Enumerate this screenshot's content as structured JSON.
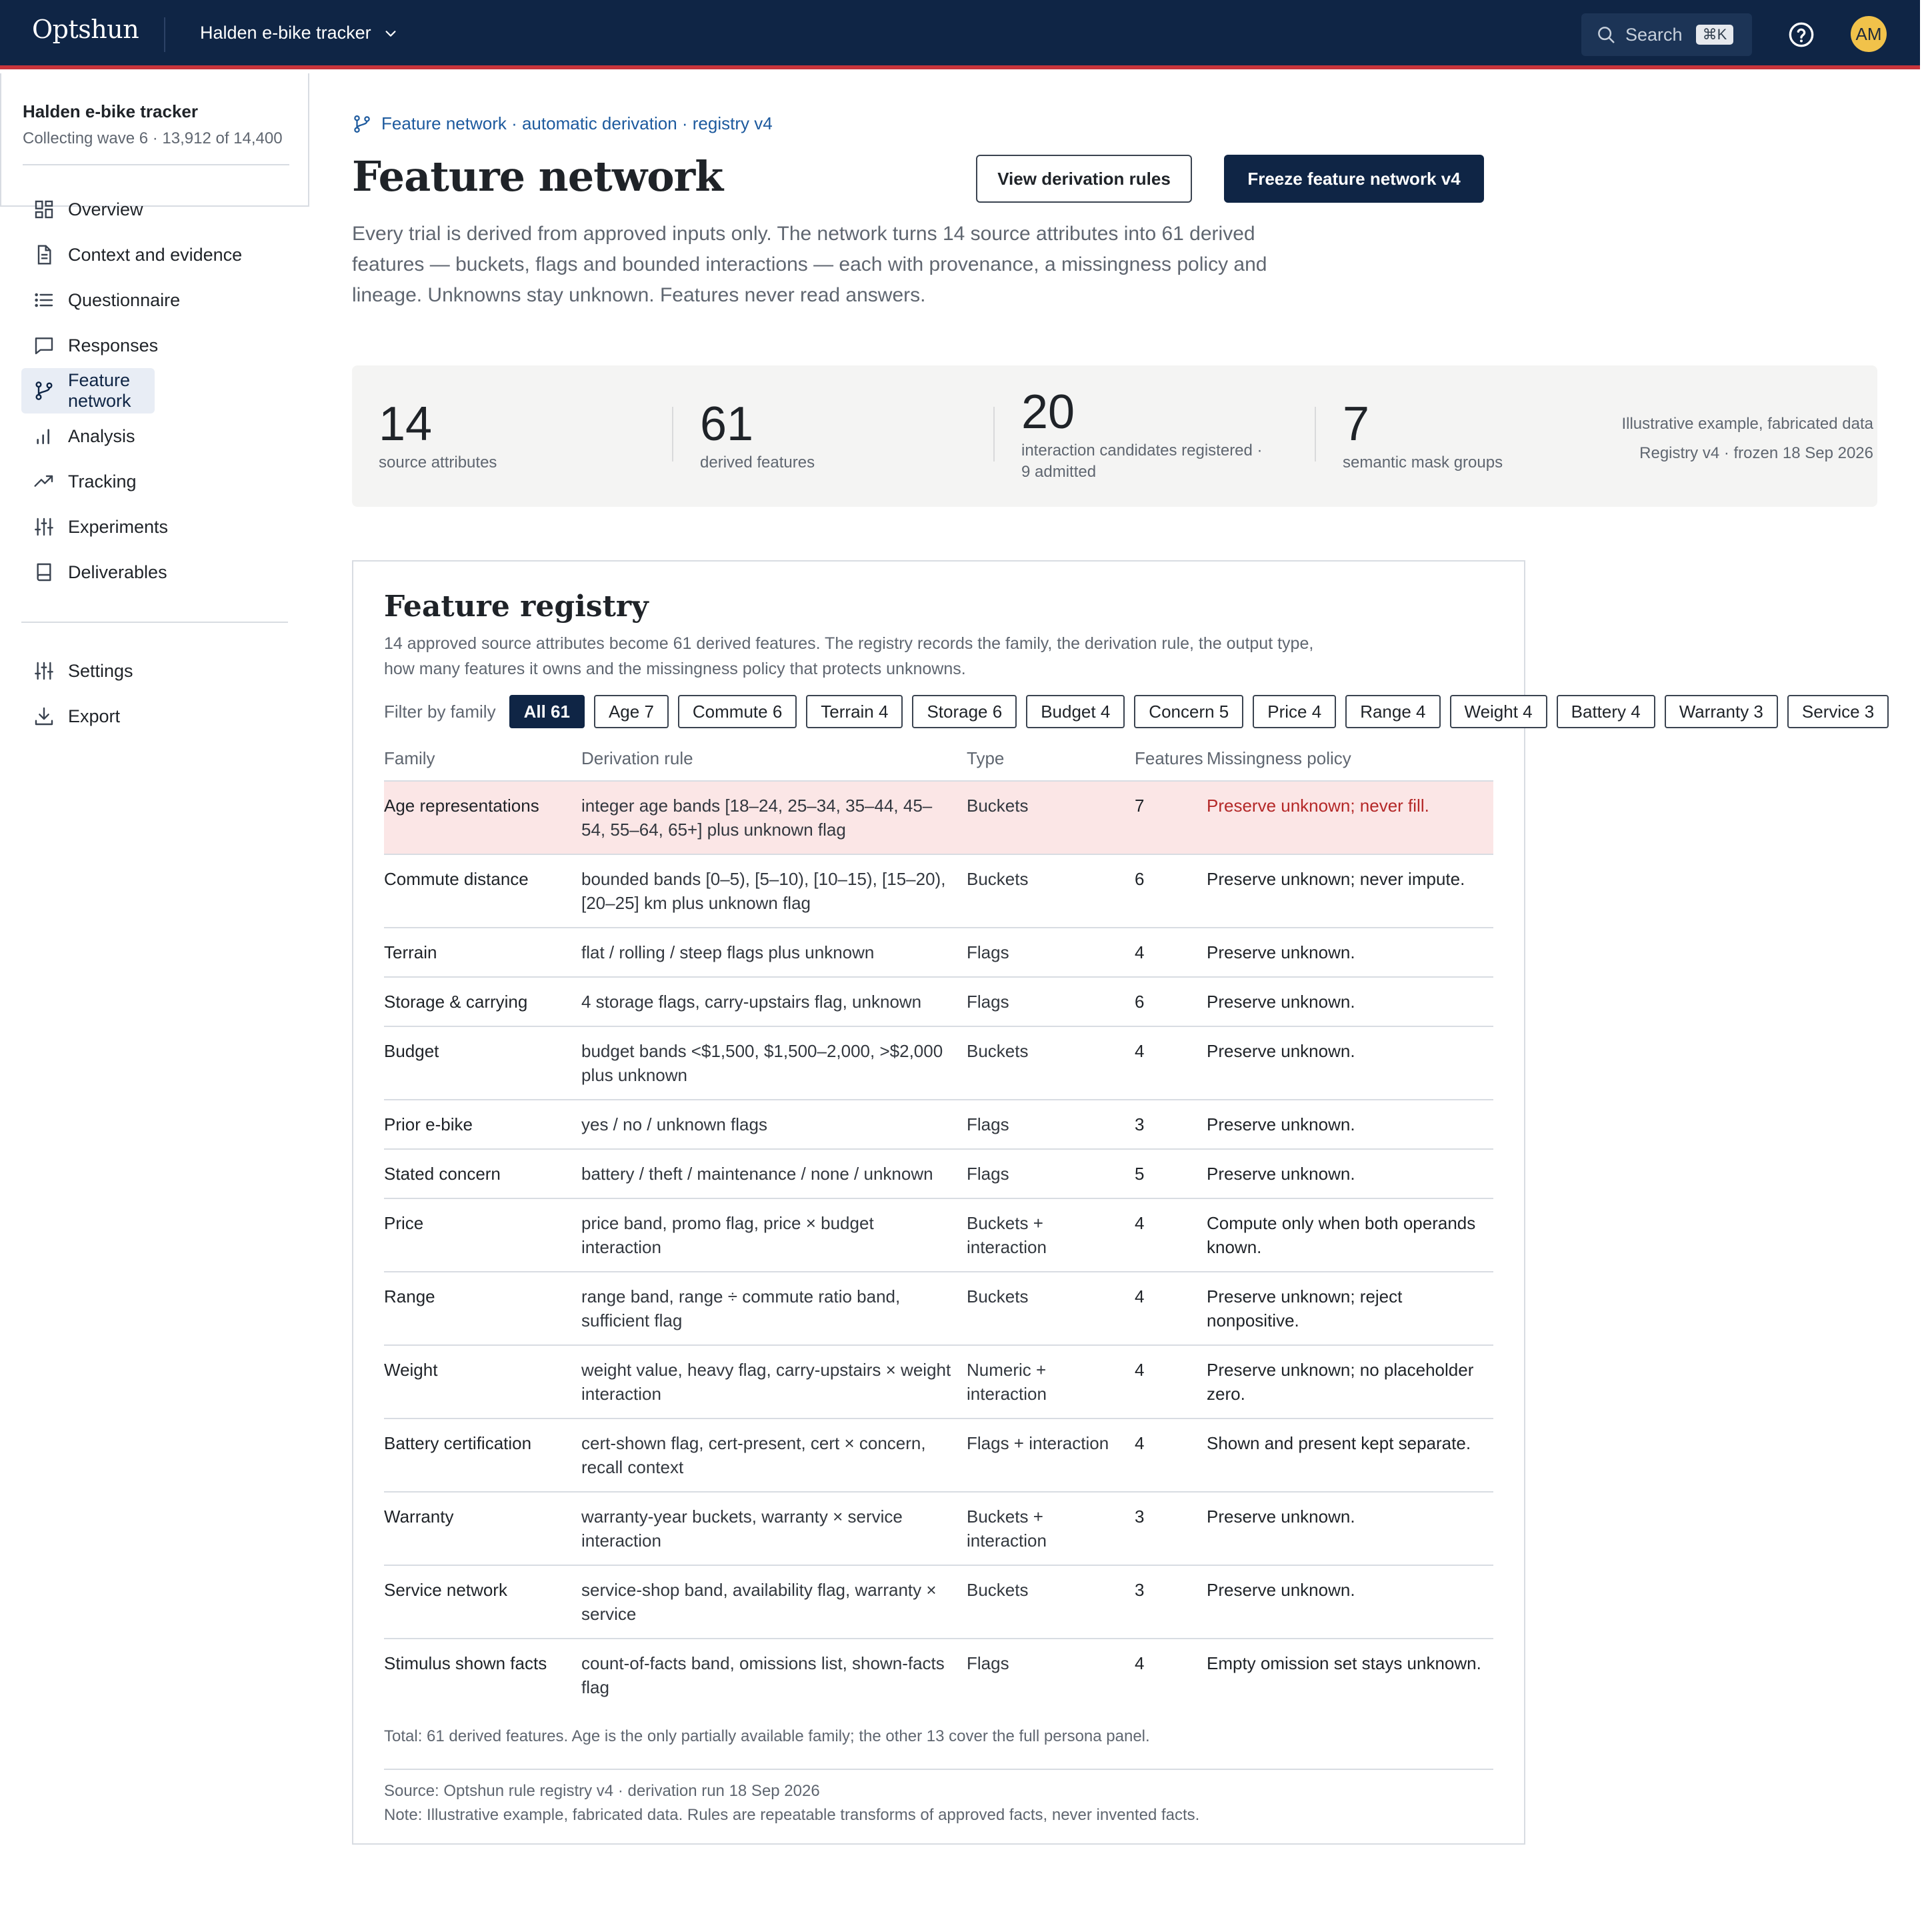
{
  "header": {
    "brand": "Optshun",
    "project_switcher": "Halden e-bike tracker",
    "search_label": "Search",
    "search_shortcut": "⌘K",
    "avatar_initials": "AM",
    "colors": {
      "bar": "#0f2545",
      "accent_line": "#c8343b",
      "avatar": "#f1c24a"
    }
  },
  "sidebar": {
    "project_name": "Halden e-bike tracker",
    "project_meta": "Collecting wave 6 · 13,912 of 14,400",
    "items": [
      {
        "label": "Overview",
        "icon": "grid-icon"
      },
      {
        "label": "Context and evidence",
        "icon": "document-icon"
      },
      {
        "label": "Questionnaire",
        "icon": "list-icon"
      },
      {
        "label": "Responses",
        "icon": "chat-icon"
      },
      {
        "label": "Feature network",
        "icon": "branch-icon",
        "active": true
      },
      {
        "label": "Analysis",
        "icon": "bar-chart-icon"
      },
      {
        "label": "Tracking",
        "icon": "trend-up-icon"
      },
      {
        "label": "Experiments",
        "icon": "sliders-icon"
      },
      {
        "label": "Deliverables",
        "icon": "book-icon"
      }
    ],
    "secondary": [
      {
        "label": "Settings",
        "icon": "sliders-icon"
      },
      {
        "label": "Export",
        "icon": "download-icon"
      }
    ]
  },
  "main": {
    "breadcrumb": "Feature network · automatic derivation · registry v4",
    "title": "Feature network",
    "view_rules_label": "View derivation rules",
    "freeze_label": "Freeze feature network v4",
    "lede": "Every trial is derived from approved inputs only. The network turns 14 source attributes into 61 derived features — buckets, flags and bounded interactions — each with provenance, a missingness policy and lineage. Unknowns stay unknown. Features never read answers."
  },
  "stats": {
    "items": [
      {
        "value": "14",
        "label": "source attributes"
      },
      {
        "value": "61",
        "label": "derived features"
      },
      {
        "value": "20",
        "label": "interaction candidates registered ·",
        "label2": "9 admitted"
      },
      {
        "value": "7",
        "label": "semantic mask groups"
      }
    ],
    "note_line1": "Illustrative example, fabricated data",
    "note_line2": "Registry v4 · frozen 18 Sep 2026"
  },
  "registry": {
    "title": "Feature registry",
    "description": "14 approved source attributes become 61 derived features. The registry records the family, the derivation rule, the output type, how many features it owns and the missingness policy that protects unknowns.",
    "filter_label": "Filter by family",
    "filters": [
      {
        "label": "All 61",
        "active": true
      },
      {
        "label": "Age 7"
      },
      {
        "label": "Commute 6"
      },
      {
        "label": "Terrain 4"
      },
      {
        "label": "Storage 6"
      },
      {
        "label": "Budget 4"
      },
      {
        "label": "Concern 5"
      },
      {
        "label": "Price 4"
      },
      {
        "label": "Range 4"
      },
      {
        "label": "Weight 4"
      },
      {
        "label": "Battery 4"
      },
      {
        "label": "Warranty 3"
      },
      {
        "label": "Service 3"
      }
    ],
    "columns": [
      "Family",
      "Derivation rule",
      "Type",
      "Features",
      "Missingness policy"
    ],
    "rows": [
      {
        "family": "Age representations",
        "rule": "integer age bands [18–24, 25–34, 35–44, 45–54, 55–64, 65+] plus unknown flag",
        "type": "Buckets",
        "features": "7",
        "policy": "Preserve unknown; never fill.",
        "highlight": true
      },
      {
        "family": "Commute distance",
        "rule": "bounded bands [0–5), [5–10), [10–15), [15–20), [20–25] km plus unknown flag",
        "type": "Buckets",
        "features": "6",
        "policy": "Preserve unknown; never impute."
      },
      {
        "family": "Terrain",
        "rule": "flat / rolling / steep flags plus unknown",
        "type": "Flags",
        "features": "4",
        "policy": "Preserve unknown."
      },
      {
        "family": "Storage & carrying",
        "rule": "4 storage flags, carry-upstairs flag, unknown",
        "type": "Flags",
        "features": "6",
        "policy": "Preserve unknown."
      },
      {
        "family": "Budget",
        "rule": "budget bands <$1,500, $1,500–2,000, >$2,000 plus unknown",
        "type": "Buckets",
        "features": "4",
        "policy": "Preserve unknown."
      },
      {
        "family": "Prior e-bike",
        "rule": "yes / no / unknown flags",
        "type": "Flags",
        "features": "3",
        "policy": "Preserve unknown."
      },
      {
        "family": "Stated concern",
        "rule": "battery / theft / maintenance / none / unknown",
        "type": "Flags",
        "features": "5",
        "policy": "Preserve unknown."
      },
      {
        "family": "Price",
        "rule": "price band, promo flag, price × budget interaction",
        "type": "Buckets + interaction",
        "features": "4",
        "policy": "Compute only when both operands known."
      },
      {
        "family": "Range",
        "rule": "range band, range ÷ commute ratio band, sufficient flag",
        "type": "Buckets",
        "features": "4",
        "policy": "Preserve unknown; reject nonpositive."
      },
      {
        "family": "Weight",
        "rule": "weight value, heavy flag, carry-upstairs × weight interaction",
        "type": "Numeric + interaction",
        "features": "4",
        "policy": "Preserve unknown; no placeholder zero."
      },
      {
        "family": "Battery certification",
        "rule": "cert-shown flag, cert-present, cert × concern, recall context",
        "type": "Flags + interaction",
        "features": "4",
        "policy": "Shown and present kept separate."
      },
      {
        "family": "Warranty",
        "rule": "warranty-year buckets, warranty × service interaction",
        "type": "Buckets + interaction",
        "features": "3",
        "policy": "Preserve unknown."
      },
      {
        "family": "Service network",
        "rule": "service-shop band, availability flag, warranty × service",
        "type": "Buckets",
        "features": "3",
        "policy": "Preserve unknown."
      },
      {
        "family": "Stimulus shown facts",
        "rule": "count-of-facts band, omissions list, shown-facts flag",
        "type": "Flags",
        "features": "4",
        "policy": "Empty omission set stays unknown."
      }
    ],
    "total": "Total: 61 derived features. Age is the only partially available family; the other 13 cover the full persona panel.",
    "source": "Source: Optshun rule registry v4 · derivation run 18 Sep 2026",
    "note": "Note: Illustrative example, fabricated data. Rules are repeatable transforms of approved facts, never invented facts.",
    "colors": {
      "highlight_row": "#fbe6e6",
      "highlight_text": "#b42828"
    }
  }
}
